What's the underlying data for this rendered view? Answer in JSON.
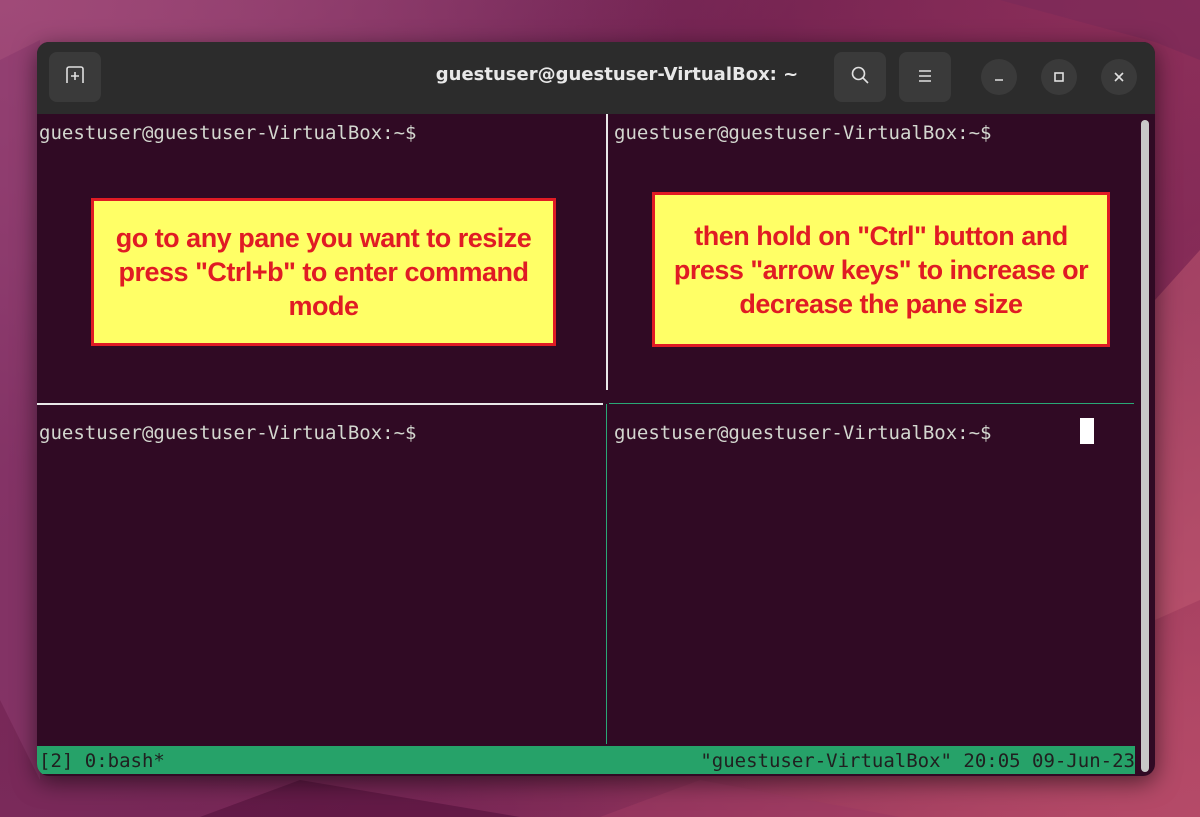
{
  "window": {
    "title": "guestuser@guestuser-VirtualBox: ~"
  },
  "titlebar_icons": {
    "new_tab": "new-tab-icon",
    "search": "search-icon",
    "menu": "hamburger-menu-icon",
    "minimize": "minimize-icon",
    "maximize": "maximize-icon",
    "close": "close-icon"
  },
  "panes": [
    {
      "prompt": "guestuser@guestuser-VirtualBox:~$"
    },
    {
      "prompt": "guestuser@guestuser-VirtualBox:~$"
    },
    {
      "prompt": "guestuser@guestuser-VirtualBox:~$"
    },
    {
      "prompt": "guestuser@guestuser-VirtualBox:~$"
    }
  ],
  "statusbar": {
    "left": "[2] 0:bash*",
    "right": "\"guestuser-VirtualBox\" 20:05 09-Jun-23"
  },
  "annotations": {
    "left": "go to any pane you want to resize press \"Ctrl+b\" to enter command mode",
    "right": "then hold on \"Ctrl\" button and press \"arrow keys\" to increase or decrease the pane size"
  },
  "colors": {
    "terminal_bg": "#300a24",
    "status_bar": "#26a269",
    "annotation_bg": "#ffff66",
    "annotation_text": "#e01b24"
  }
}
